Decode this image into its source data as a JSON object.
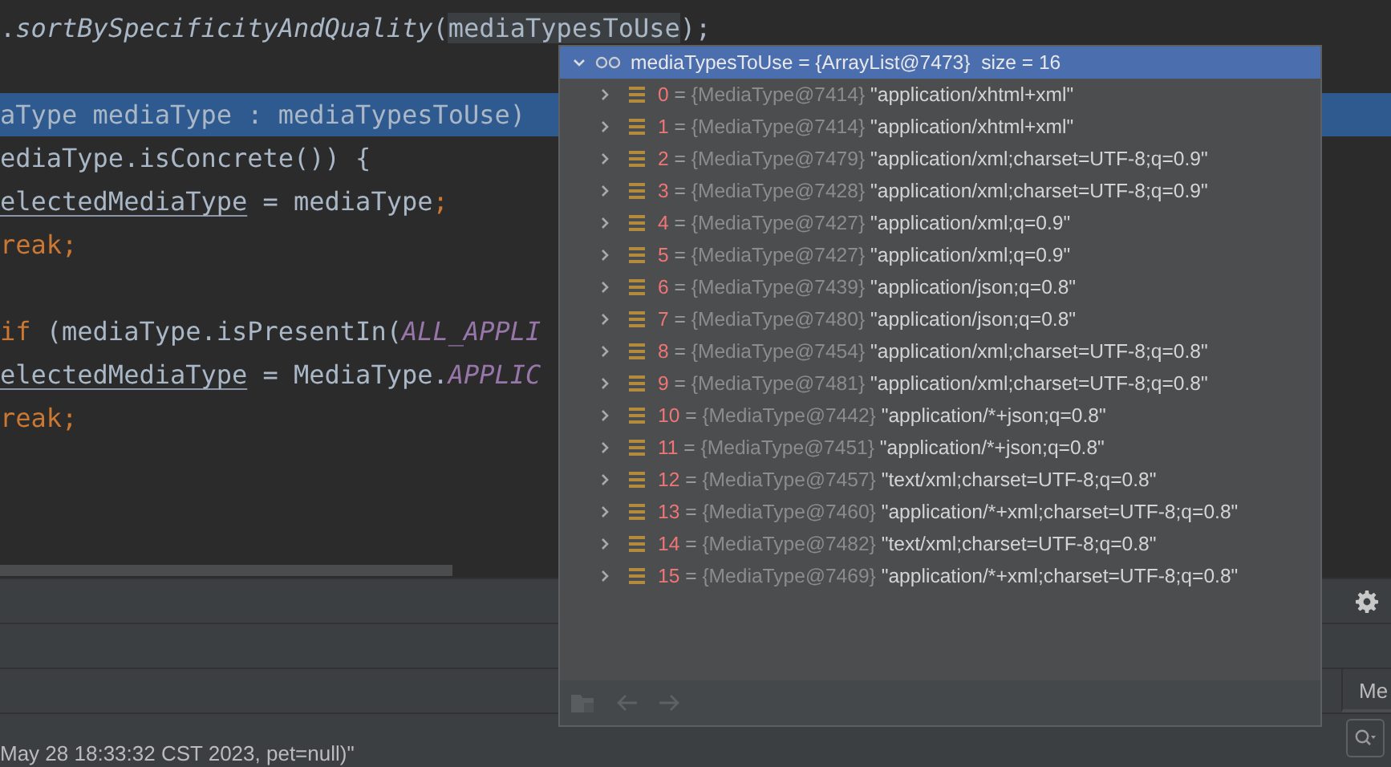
{
  "editor": {
    "lines": [
      {
        "kind": "code",
        "selected": false,
        "tokens": [
          {
            "text": ".",
            "kind": "plain"
          },
          {
            "text": "sortBySpecificityAndQuality",
            "kind": "method"
          },
          {
            "text": "(",
            "kind": "plain"
          },
          {
            "text": "mediaTypesToUse",
            "kind": "ref"
          },
          {
            "text": ");",
            "kind": "plain"
          }
        ]
      },
      {
        "kind": "blank"
      },
      {
        "kind": "code",
        "selected": true,
        "tokens": [
          {
            "text": "aType mediaType : mediaTypesToUse)",
            "kind": "plain"
          }
        ]
      },
      {
        "kind": "code",
        "selected": false,
        "tokens": [
          {
            "text": "ediaType.isConcrete()) {",
            "kind": "plain"
          }
        ]
      },
      {
        "kind": "code",
        "selected": false,
        "tokens": [
          {
            "text": "electedMediaType",
            "kind": "local"
          },
          {
            "text": " = mediaType",
            "kind": "plain"
          },
          {
            "text": ";",
            "kind": "keyword"
          }
        ]
      },
      {
        "kind": "code",
        "selected": false,
        "tokens": [
          {
            "text": "reak;",
            "kind": "keyword"
          }
        ]
      },
      {
        "kind": "blank"
      },
      {
        "kind": "code",
        "selected": false,
        "tokens": [
          {
            "text": "if",
            "kind": "keyword"
          },
          {
            "text": " (mediaType.isPresentIn(",
            "kind": "plain"
          },
          {
            "text": "ALL_APPLI",
            "kind": "static"
          }
        ]
      },
      {
        "kind": "code",
        "selected": false,
        "tokens": [
          {
            "text": "electedMediaType",
            "kind": "local"
          },
          {
            "text": " = MediaType.",
            "kind": "plain"
          },
          {
            "text": "APPLIC",
            "kind": "static"
          }
        ]
      },
      {
        "kind": "code",
        "selected": false,
        "tokens": [
          {
            "text": "reak;",
            "kind": "keyword"
          }
        ]
      }
    ]
  },
  "popup": {
    "header": {
      "expanded": true,
      "label": "mediaTypesToUse = {ArrayList@7473}  size = 16"
    },
    "rows": [
      {
        "index": "0",
        "sep": "=",
        "type": "{MediaType@7414}",
        "value": "\"application/xhtml+xml\"",
        "expanded": false
      },
      {
        "index": "1",
        "sep": "=",
        "type": "{MediaType@7414}",
        "value": "\"application/xhtml+xml\"",
        "expanded": false
      },
      {
        "index": "2",
        "sep": "=",
        "type": "{MediaType@7479}",
        "value": "\"application/xml;charset=UTF-8;q=0.9\"",
        "expanded": false
      },
      {
        "index": "3",
        "sep": "=",
        "type": "{MediaType@7428}",
        "value": "\"application/xml;charset=UTF-8;q=0.9\"",
        "expanded": false
      },
      {
        "index": "4",
        "sep": "=",
        "type": "{MediaType@7427}",
        "value": "\"application/xml;q=0.9\"",
        "expanded": false
      },
      {
        "index": "5",
        "sep": "=",
        "type": "{MediaType@7427}",
        "value": "\"application/xml;q=0.9\"",
        "expanded": false
      },
      {
        "index": "6",
        "sep": "=",
        "type": "{MediaType@7439}",
        "value": "\"application/json;q=0.8\"",
        "expanded": false
      },
      {
        "index": "7",
        "sep": "=",
        "type": "{MediaType@7480}",
        "value": "\"application/json;q=0.8\"",
        "expanded": false
      },
      {
        "index": "8",
        "sep": "=",
        "type": "{MediaType@7454}",
        "value": "\"application/xml;charset=UTF-8;q=0.8\"",
        "expanded": false
      },
      {
        "index": "9",
        "sep": "=",
        "type": "{MediaType@7481}",
        "value": "\"application/xml;charset=UTF-8;q=0.8\"",
        "expanded": false
      },
      {
        "index": "10",
        "sep": "=",
        "type": "{MediaType@7442}",
        "value": "\"application/*+json;q=0.8\"",
        "expanded": false
      },
      {
        "index": "11",
        "sep": "=",
        "type": "{MediaType@7451}",
        "value": "\"application/*+json;q=0.8\"",
        "expanded": false
      },
      {
        "index": "12",
        "sep": "=",
        "type": "{MediaType@7457}",
        "value": "\"text/xml;charset=UTF-8;q=0.8\"",
        "expanded": false
      },
      {
        "index": "13",
        "sep": "=",
        "type": "{MediaType@7460}",
        "value": "\"application/*+xml;charset=UTF-8;q=0.8\"",
        "expanded": false
      },
      {
        "index": "14",
        "sep": "=",
        "type": "{MediaType@7482}",
        "value": "\"text/xml;charset=UTF-8;q=0.8\"",
        "expanded": false
      },
      {
        "index": "15",
        "sep": "=",
        "type": "{MediaType@7469}",
        "value": "\"application/*+xml;charset=UTF-8;q=0.8\"",
        "expanded": false
      }
    ]
  },
  "side_tab": {
    "label": "Me"
  },
  "console": {
    "line": "May 28 18:33:32 CST 2023, pet=null)\""
  }
}
